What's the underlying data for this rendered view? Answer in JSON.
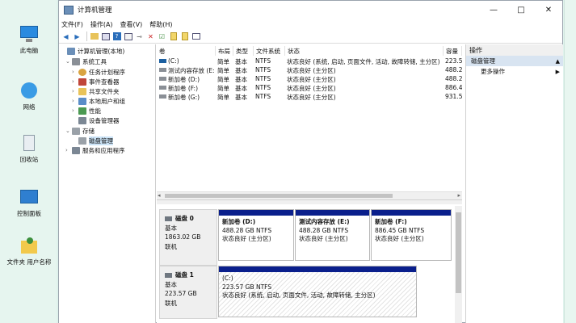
{
  "desktop": {
    "icons": [
      {
        "label": "此电脑",
        "icon": "computer-icon"
      },
      {
        "label": "网络",
        "icon": "network-icon"
      },
      {
        "label": "回收站",
        "icon": "recycle-bin-icon"
      },
      {
        "label": "控制面板",
        "icon": "control-panel-icon"
      },
      {
        "label": "文件夹 用户名称",
        "icon": "user-folder-icon"
      }
    ]
  },
  "window": {
    "title": "计算机管理",
    "controls": {
      "minimize": "—",
      "maximize": "□",
      "close": "✕"
    }
  },
  "menu": [
    "文件(F)",
    "操作(A)",
    "查看(V)",
    "帮助(H)"
  ],
  "toolbar_icons": [
    "back-icon",
    "forward-icon",
    "up-folder-icon",
    "view-icon",
    "help-icon",
    "properties-icon",
    "connect-icon",
    "delete-icon",
    "check-icon",
    "new-icon",
    "export-icon",
    "console-icon"
  ],
  "tree": {
    "root": "计算机管理(本地)",
    "system_tools": "系统工具",
    "task_scheduler": "任务计划程序",
    "event_viewer": "事件查看器",
    "shared_folders": "共享文件夹",
    "local_users": "本地用户和组",
    "performance": "性能",
    "device_manager": "设备管理器",
    "storage": "存储",
    "disk_management": "磁盘管理",
    "services": "服务和应用程序"
  },
  "volumes": {
    "headers": [
      "卷",
      "布局",
      "类型",
      "文件系统",
      "状态",
      "容量"
    ],
    "rows": [
      [
        "(C:)",
        "简单",
        "基本",
        "NTFS",
        "状态良好 (系统, 启动, 页面文件, 活动, 故障转储, 主分区)",
        "223.5"
      ],
      [
        "测试内容存放 (E:)",
        "简单",
        "基本",
        "NTFS",
        "状态良好 (主分区)",
        "488.2"
      ],
      [
        "新加卷 (D:)",
        "简单",
        "基本",
        "NTFS",
        "状态良好 (主分区)",
        "488.2"
      ],
      [
        "新加卷 (F:)",
        "简单",
        "基本",
        "NTFS",
        "状态良好 (主分区)",
        "886.4"
      ],
      [
        "新加卷 (G:)",
        "简单",
        "基本",
        "NTFS",
        "状态良好 (主分区)",
        "931.5"
      ]
    ]
  },
  "disks": [
    {
      "name": "磁盘 0",
      "type": "基本",
      "size": "1863.02 GB",
      "status": "联机",
      "partitions": [
        {
          "name": "新加卷 (D:)",
          "size": "488.28 GB NTFS",
          "status": "状态良好 (主分区)"
        },
        {
          "name": "测试内容存放 (E:)",
          "size": "488.28 GB NTFS",
          "status": "状态良好 (主分区)"
        },
        {
          "name": "新加卷 (F:)",
          "size": "886.45 GB NTFS",
          "status": "状态良好 (主分区)"
        }
      ]
    },
    {
      "name": "磁盘 1",
      "type": "基本",
      "size": "223.57 GB",
      "status": "联机",
      "partitions": [
        {
          "name": "(C:)",
          "size": "223.57 GB NTFS",
          "status": "状态良好 (系统, 启动, 页面文件, 活动, 故障转储, 主分区)"
        }
      ]
    }
  ],
  "actions": {
    "header": "操作",
    "section": "磁盘管理",
    "more": "更多操作"
  },
  "colors": {
    "partition_bar": "#0a1f8c",
    "selected": "#cce4f7"
  }
}
